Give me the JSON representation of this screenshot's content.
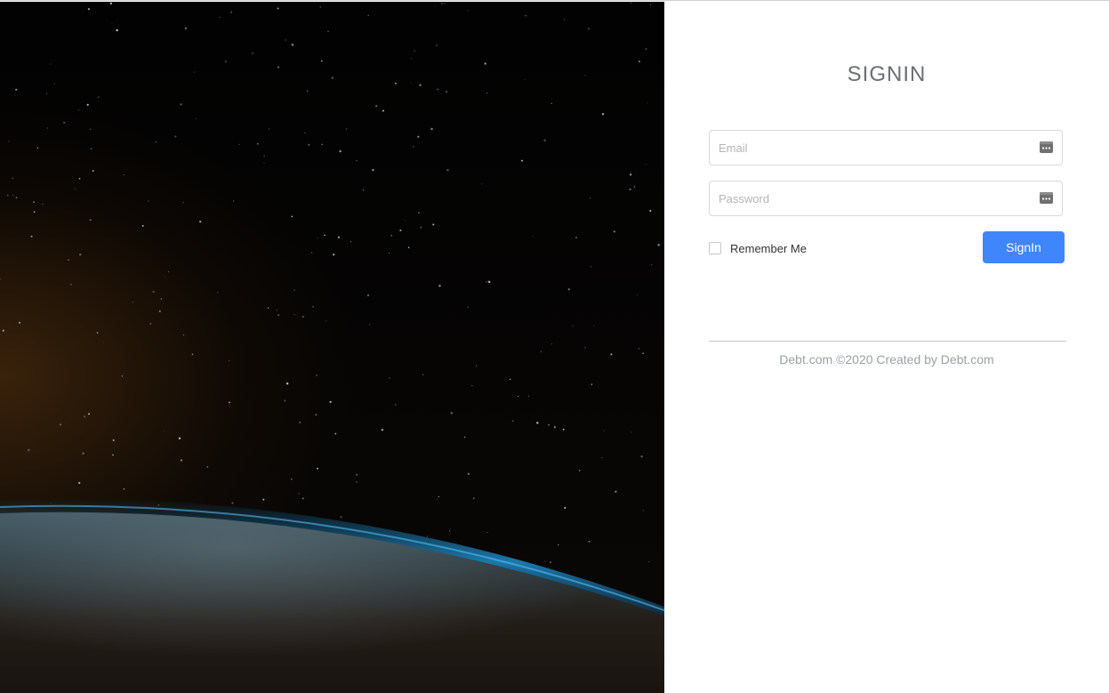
{
  "signin": {
    "title": "SIGNIN",
    "email_placeholder": "Email",
    "password_placeholder": "Password",
    "remember_label": "Remember Me",
    "remember_checked": false,
    "submit_label": "SignIn",
    "footer": "Debt.com ©2020 Created by Debt.com"
  },
  "icons": {
    "field_icon": "password-manager-key-icon",
    "hero_image": "earth-from-space-image"
  },
  "colors": {
    "primary": "#3f85fb",
    "title": "#6b6f75",
    "footer": "#9aa0a6",
    "input_border": "#d9d9d9"
  }
}
